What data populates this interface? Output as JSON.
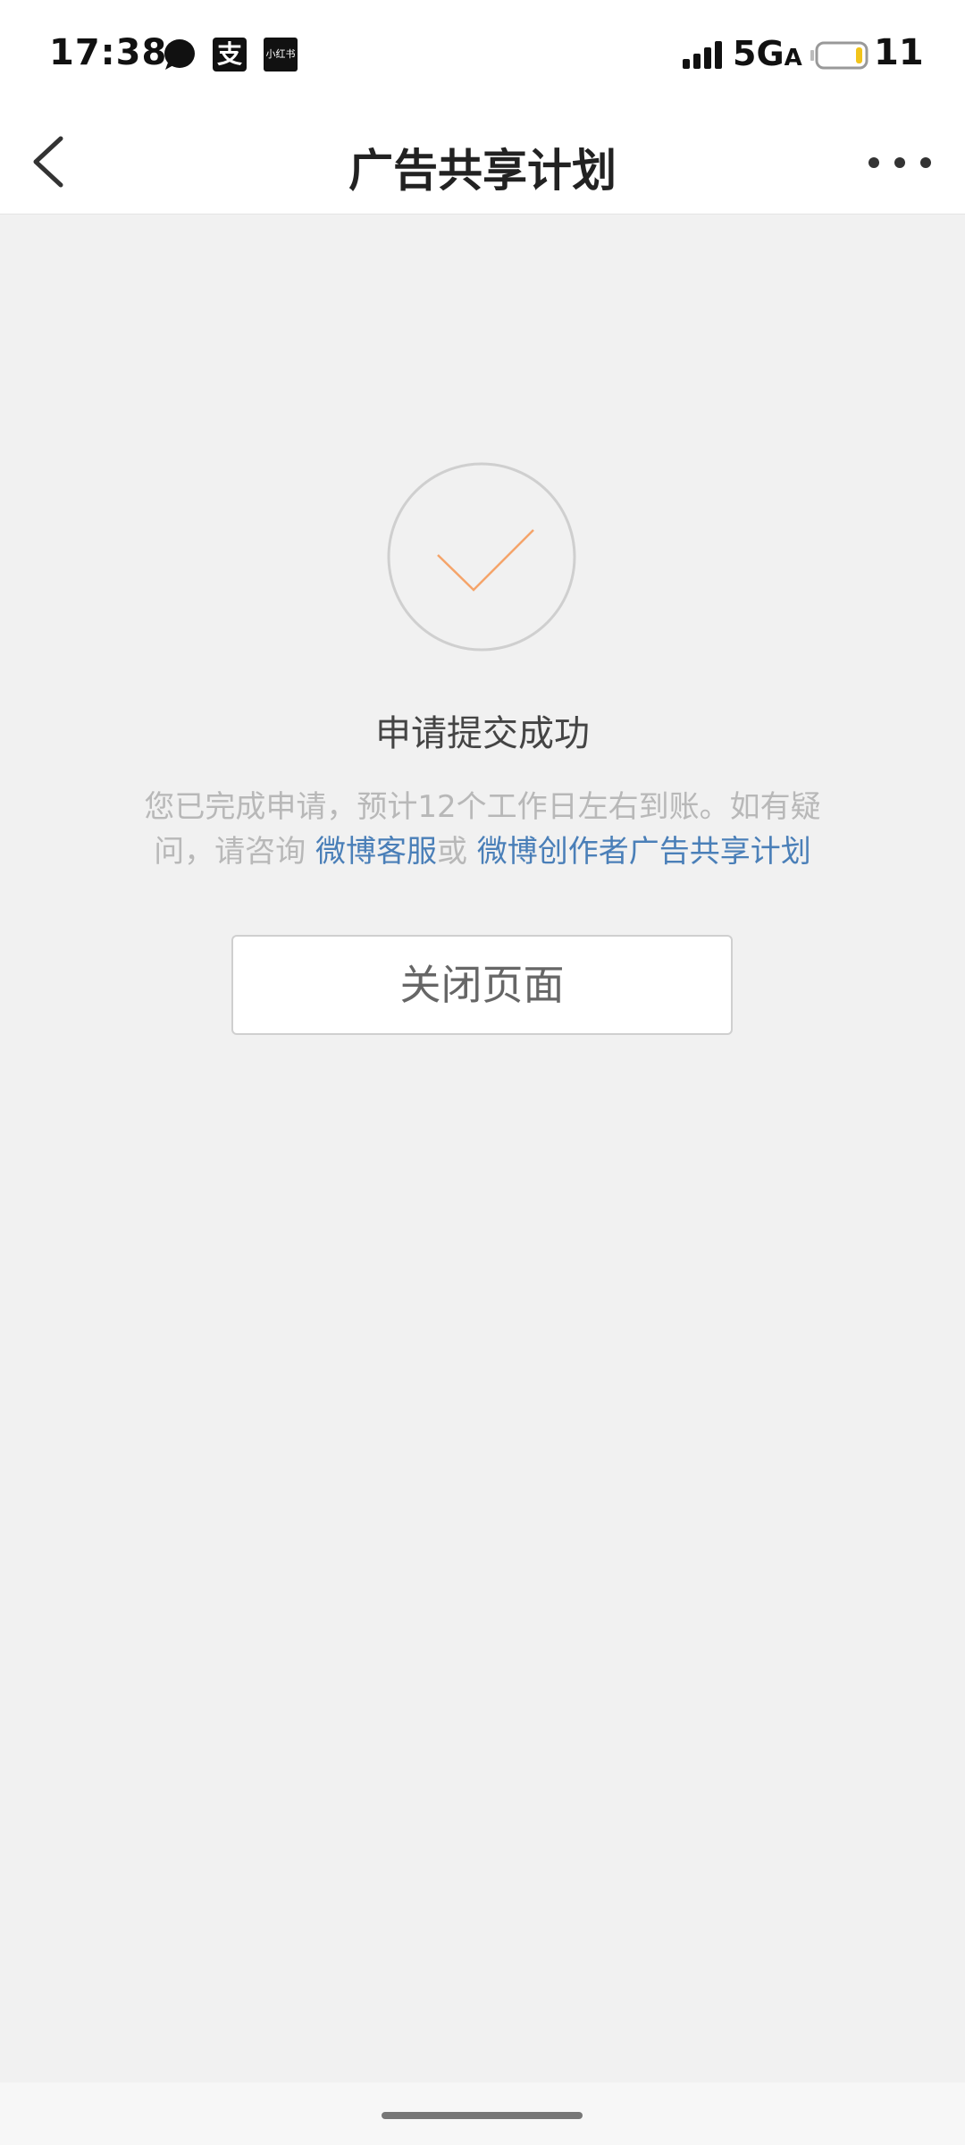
{
  "status_bar": {
    "time": "17:38",
    "notification_icons": [
      "chat-bubble-icon",
      "alipay-icon",
      "xiaohongshu-icon"
    ],
    "alipay_glyph": "支",
    "xiaohongshu_glyph": "小红书",
    "network": "5G",
    "network_suffix": "A",
    "signal_icon": "signal-bars-icon",
    "battery_icon": "battery-icon",
    "battery_level": "11"
  },
  "nav": {
    "back_icon": "chevron-left-icon",
    "title": "广告共享计划",
    "more_icon": "more-dots-icon"
  },
  "result": {
    "icon": "check-circle-icon",
    "title": "申请提交成功",
    "desc_prefix": "您已完成申请，预计12个工作日左右到账。如有疑问，请咨询 ",
    "link_service": "微博客服",
    "desc_or": "或 ",
    "link_plan": "微博创作者广告共享计划",
    "close_button": "关闭页面"
  },
  "colors": {
    "accent_check": "#f5a46a",
    "link": "#4a7fb8",
    "background": "#f1f1f1"
  }
}
